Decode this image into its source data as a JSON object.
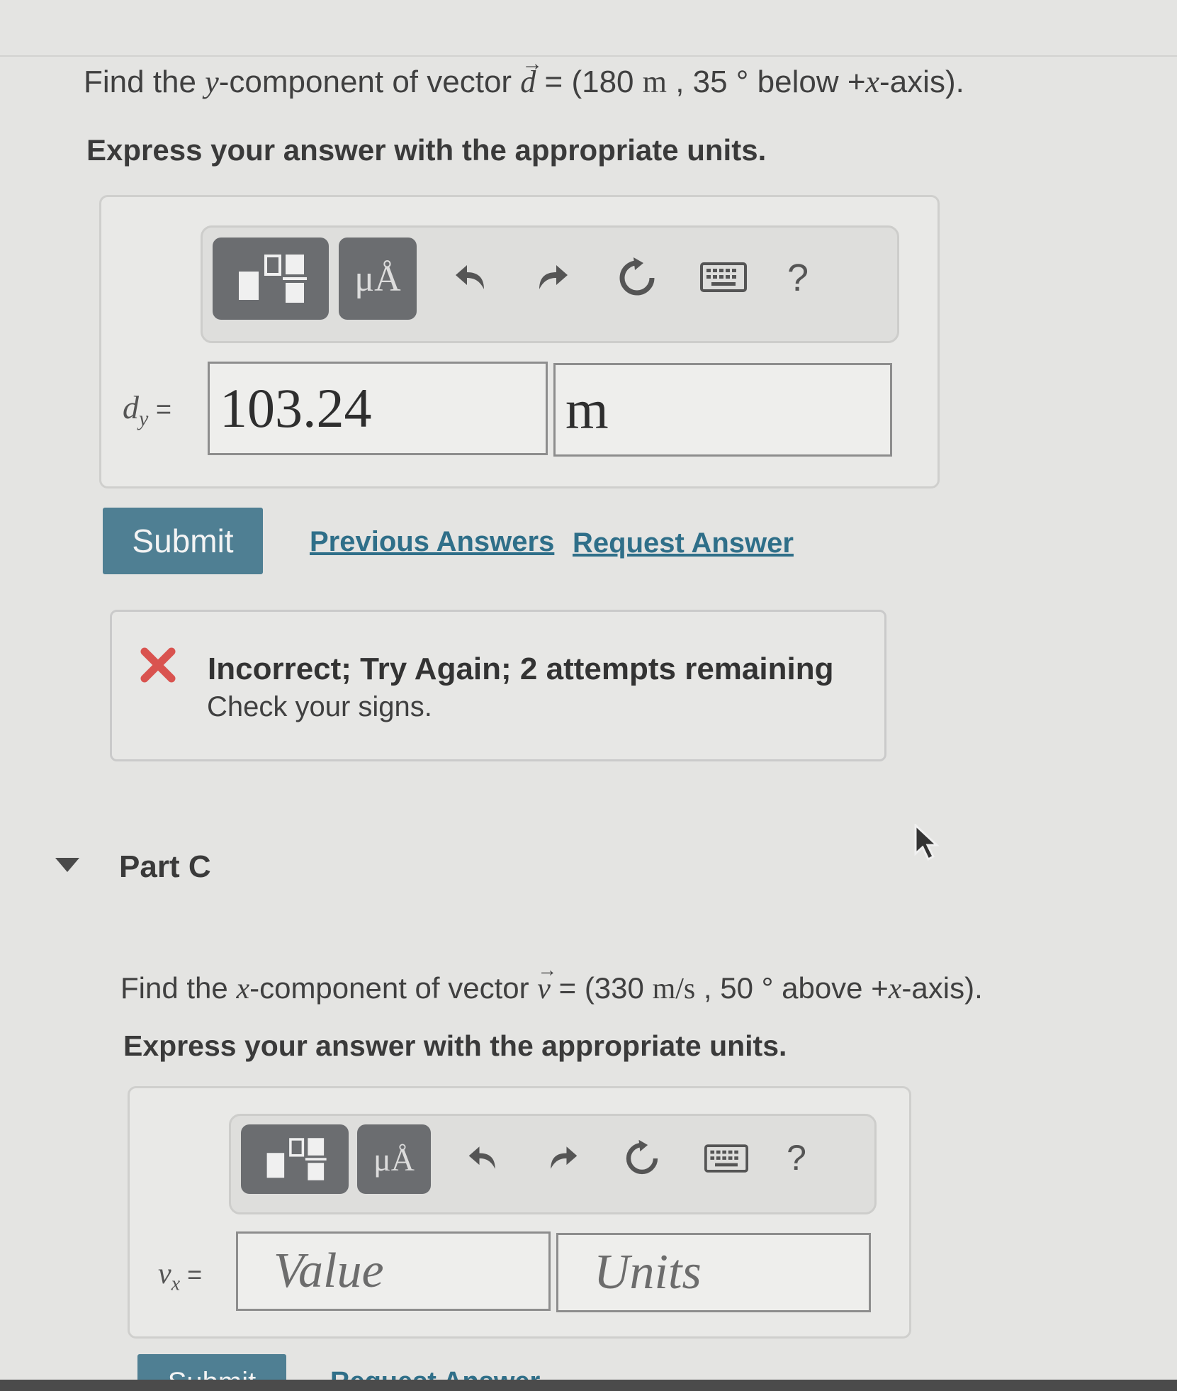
{
  "part_b": {
    "question_prefix": "Find the ",
    "question_var": "y",
    "question_mid": "-component of vector ",
    "vector_symbol": "d",
    "question_eq": " = (180  ",
    "unit": "m",
    "question_angle": " , 35 °  below +",
    "axis_var": "x",
    "question_end": "-axis).",
    "instruction": "Express your answer with the appropriate units.",
    "toolbar": {
      "units_button": "μÅ",
      "help": "?"
    },
    "answer_label_var": "d",
    "answer_label_sub": "y",
    "answer_label_eq": " =",
    "value": "103.24",
    "units_value": "m",
    "submit_label": "Submit",
    "previous_answers": "Previous Answers",
    "request_answer": "Request Answer",
    "feedback": {
      "title": "Incorrect; Try Again; 2 attempts remaining",
      "message": "Check your signs."
    }
  },
  "part_c": {
    "title": "Part C",
    "question_prefix": "Find the ",
    "question_var": "x",
    "question_mid": "-component of vector ",
    "vector_symbol": "v",
    "question_eq": " = (330  ",
    "unit": "m/s",
    "question_angle": " , 50 °  above +",
    "axis_var": "x",
    "question_end": "-axis).",
    "instruction": "Express your answer with the appropriate units.",
    "toolbar": {
      "units_button": "μÅ",
      "help": "?"
    },
    "answer_label_var": "v",
    "answer_label_sub": "x",
    "answer_label_eq": " =",
    "value_placeholder": "Value",
    "units_placeholder": "Units",
    "submit_label": "Submit",
    "request_answer": "Request Answer"
  },
  "colors": {
    "submit_bg": "#4f7f93",
    "link": "#2f6f89",
    "error_x": "#d9534f"
  },
  "icons": [
    "templates-icon",
    "units-icon",
    "undo-icon",
    "redo-icon",
    "reset-icon",
    "keyboard-icon",
    "help-icon",
    "error-x-icon",
    "collapse-triangle-icon",
    "mouse-cursor-icon"
  ]
}
